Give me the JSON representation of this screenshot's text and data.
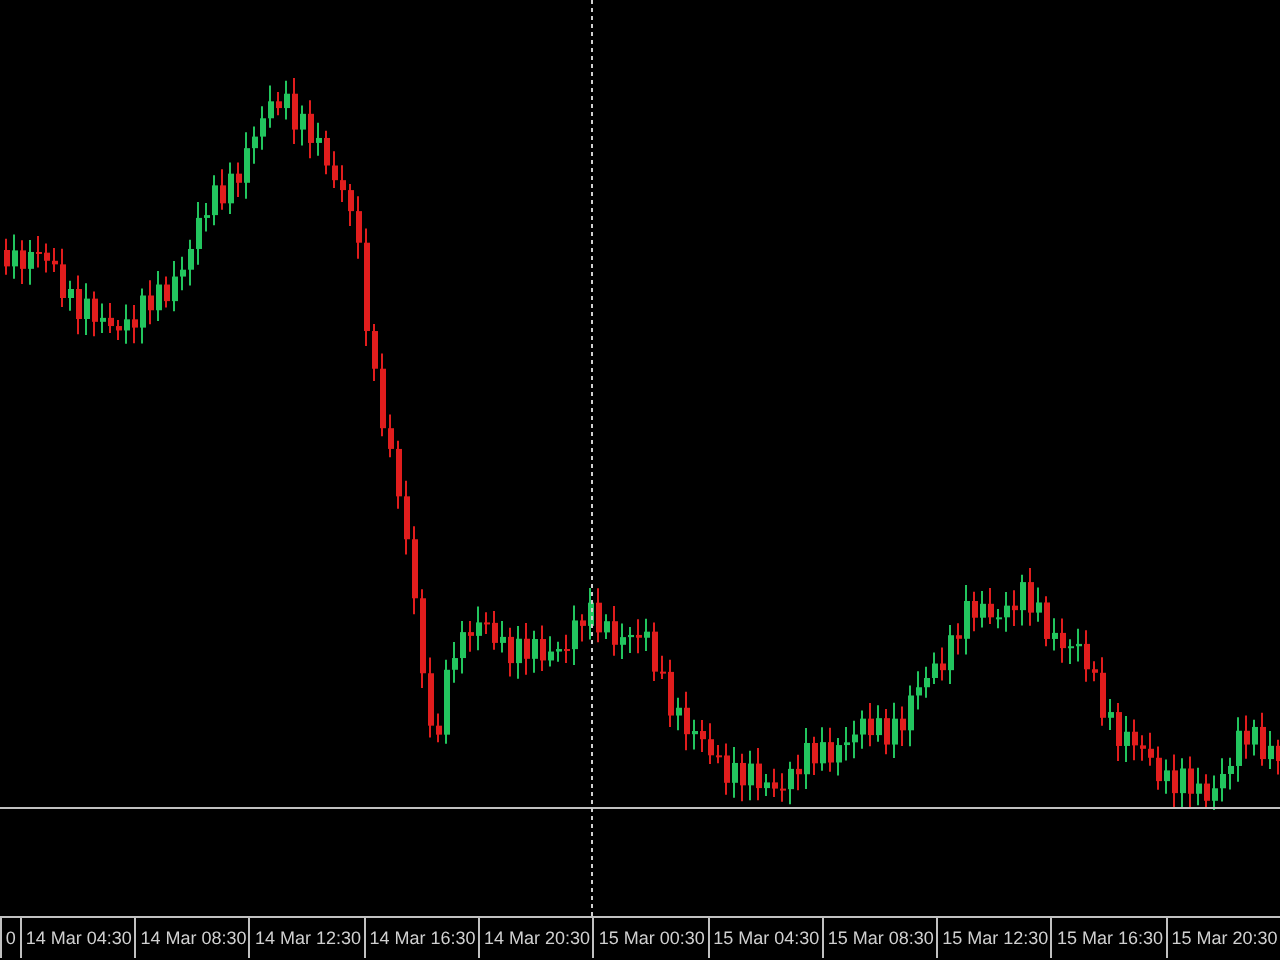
{
  "time_axis": {
    "labels": [
      "0",
      "14 Mar 04:30",
      "14 Mar 08:30",
      "14 Mar 12:30",
      "14 Mar 16:30",
      "14 Mar 20:30",
      "15 Mar 00:30",
      "15 Mar 04:30",
      "15 Mar 08:30",
      "15 Mar 12:30",
      "15 Mar 16:30",
      "15 Mar 20:30"
    ]
  }
}
